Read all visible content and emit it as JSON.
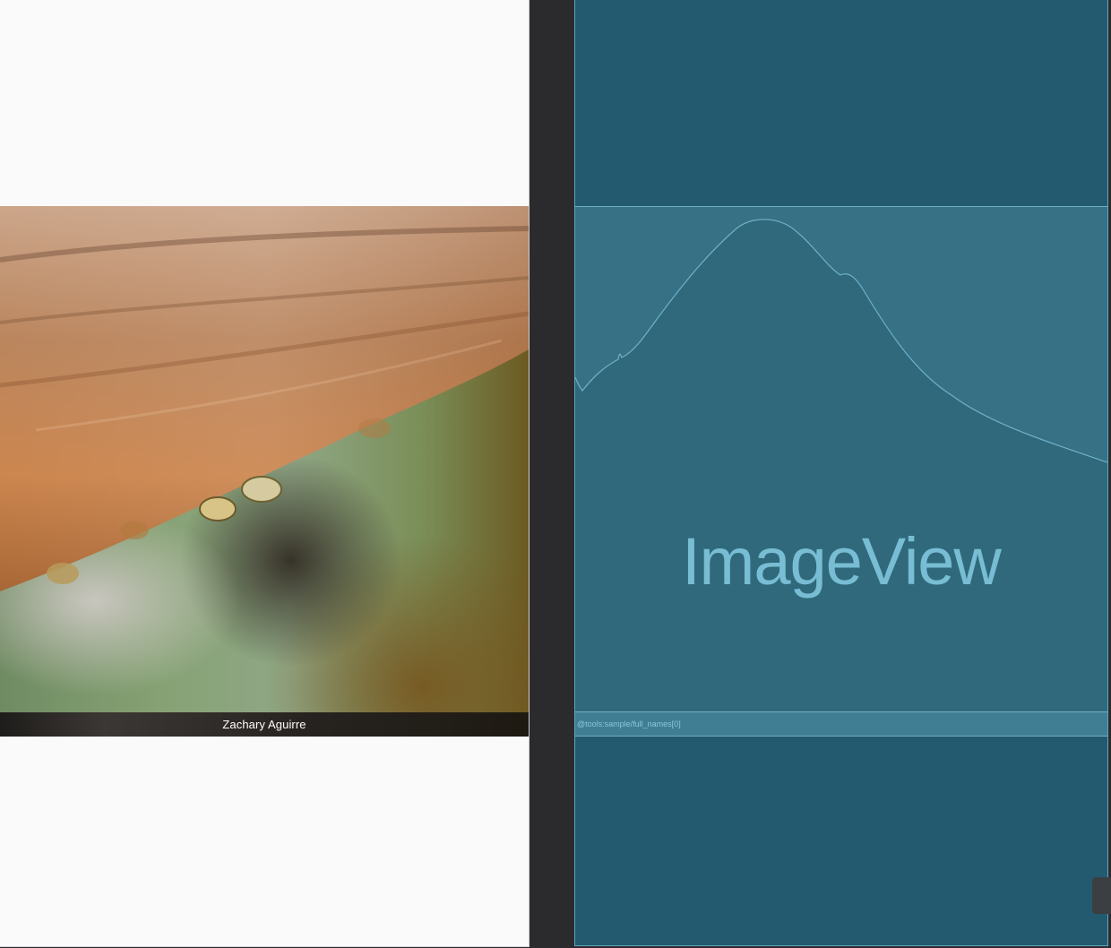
{
  "preview": {
    "caption": "Zachary Aguirre"
  },
  "blueprint": {
    "image_placeholder_label": "ImageView",
    "text_attribute": "@tools:sample/full_names[0]"
  },
  "icons": {
    "photo": "wooden-rail-with-water-droplets",
    "placeholder_curve": "mountain-silhouette-icon"
  },
  "colors": {
    "blueprint_background": "#235a6f",
    "blueprint_accent": "#78bdd3",
    "preview_background": "#fafafa",
    "ide_background": "#2b2b2d"
  }
}
